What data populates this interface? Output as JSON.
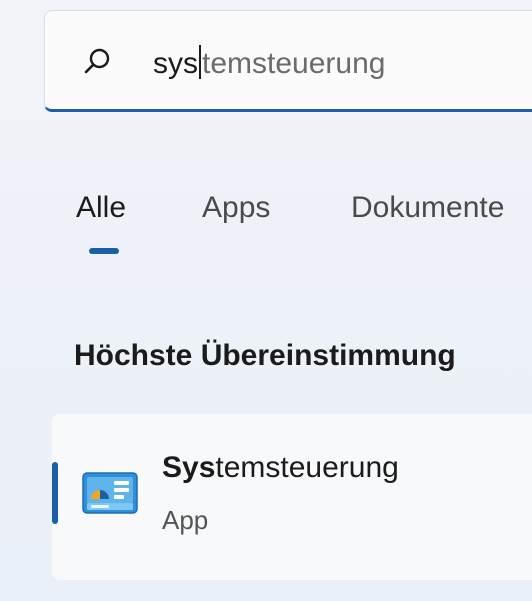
{
  "search": {
    "typed": "sys",
    "suggestion": "temsteuerung"
  },
  "tabs": [
    {
      "label": "Alle",
      "active": true
    },
    {
      "label": "Apps",
      "active": false
    },
    {
      "label": "Dokumente",
      "active": false
    }
  ],
  "best_match": {
    "heading": "Höchste Übereinstimmung",
    "result": {
      "name_match": "Sys",
      "name_rest": "temsteuerung",
      "type": "App",
      "icon": "control-panel-icon"
    }
  },
  "colors": {
    "accent": "#1a5fa8",
    "background": "#eef2f8",
    "result_background": "#f8f9fb"
  }
}
